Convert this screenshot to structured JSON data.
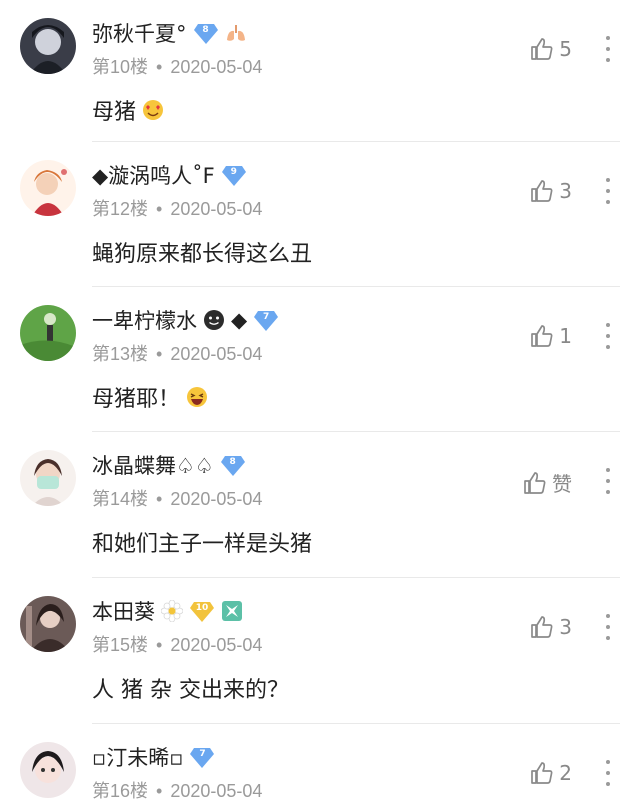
{
  "comments": [
    {
      "username": "弥秋千夏°",
      "level": "8",
      "floor": "第10楼",
      "date": "2020-05-04",
      "text": "母猪",
      "likes": "5"
    },
    {
      "username": "◆漩涡鸣人˚F",
      "level": "9",
      "floor": "第12楼",
      "date": "2020-05-04",
      "text": "蝇狗原来都长得这么丑",
      "likes": "3"
    },
    {
      "username": "一卑柠檬水",
      "username_suffix": "◆",
      "level": "7",
      "floor": "第13楼",
      "date": "2020-05-04",
      "text": "母猪耶！",
      "likes": "1"
    },
    {
      "username": "冰晶蝶舞♤♤",
      "level": "8",
      "floor": "第14楼",
      "date": "2020-05-04",
      "text": "和她们主子一样是头猪",
      "likes": "赞"
    },
    {
      "username": "本田葵",
      "level": "10",
      "floor": "第15楼",
      "date": "2020-05-04",
      "text": "人 猪 杂 交出来的？",
      "likes": "3"
    },
    {
      "username": "▫汀未晞▫",
      "level": "7",
      "floor": "第16楼",
      "date": "2020-05-04",
      "text": "",
      "likes": "2"
    }
  ],
  "meta_separator": "•",
  "colors": {
    "level_badge": "#6aa7f0",
    "gold_badge": "#f2c33c",
    "meta": "#9a9a9a",
    "text": "#222222",
    "divider": "#e9e9e9"
  },
  "icons": {
    "like": "thumbs-up-icon",
    "more": "vertical-ellipsis-icon"
  }
}
